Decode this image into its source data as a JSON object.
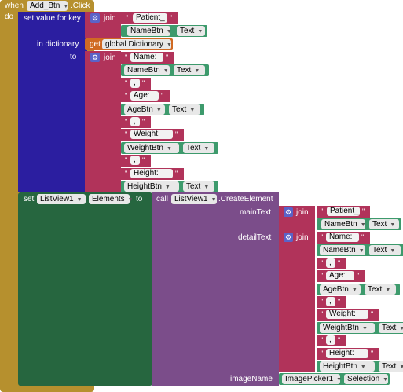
{
  "event": {
    "when": "when",
    "component": "Add_Btn",
    "event_name": ".Click",
    "do": "do"
  },
  "dict_block": {
    "title": "set value for key",
    "in_dict": "in dictionary",
    "to": "to"
  },
  "words": {
    "join": "join",
    "get": "get",
    "set": "set",
    "call": "call",
    "quote": "\""
  },
  "global_var": "global Dictionary",
  "key": {
    "text": "Patient_",
    "component": "NameBtn",
    "property": "Text"
  },
  "value_items": [
    {
      "type": "text",
      "value": "Name: "
    },
    {
      "type": "prop",
      "component": "NameBtn",
      "property": "Text"
    },
    {
      "type": "text",
      "value": ","
    },
    {
      "type": "text",
      "value": "Age: "
    },
    {
      "type": "prop",
      "component": "AgeBtn",
      "property": "Text"
    },
    {
      "type": "text",
      "value": ","
    },
    {
      "type": "text",
      "value": "Weight: "
    },
    {
      "type": "prop",
      "component": "WeightBtn",
      "property": "Text"
    },
    {
      "type": "text",
      "value": ","
    },
    {
      "type": "text",
      "value": "Height: "
    },
    {
      "type": "prop",
      "component": "HeightBtn",
      "property": "Text"
    }
  ],
  "set_block": {
    "component": "ListView1",
    "property": "Elements",
    "to": "to"
  },
  "call_block": {
    "component": "ListView1",
    "method": ".CreateElement",
    "main_label": "mainText",
    "detail_label": "detailText",
    "image_label": "imageName"
  },
  "main_text": {
    "text": "Patient_",
    "component": "NameBtn",
    "property": "Text"
  },
  "detail_items": [
    {
      "type": "text",
      "value": "Name: "
    },
    {
      "type": "prop",
      "component": "NameBtn",
      "property": "Text"
    },
    {
      "type": "text",
      "value": ","
    },
    {
      "type": "text",
      "value": "Age: "
    },
    {
      "type": "prop",
      "component": "AgeBtn",
      "property": "Text"
    },
    {
      "type": "text",
      "value": ","
    },
    {
      "type": "text",
      "value": "Weight: "
    },
    {
      "type": "prop",
      "component": "WeightBtn",
      "property": "Text"
    },
    {
      "type": "text",
      "value": ","
    },
    {
      "type": "text",
      "value": "Height: "
    },
    {
      "type": "prop",
      "component": "HeightBtn",
      "property": "Text"
    }
  ],
  "image_name": {
    "component": "ImagePicker1",
    "property": "Selection"
  },
  "colors": {
    "event": "#b6902e",
    "dictionary": "#2b1ea0",
    "text": "#b1335a",
    "component": "#3d9a6c",
    "variable": "#d06a23",
    "set": "#26663f",
    "call": "#7b4d8a"
  }
}
